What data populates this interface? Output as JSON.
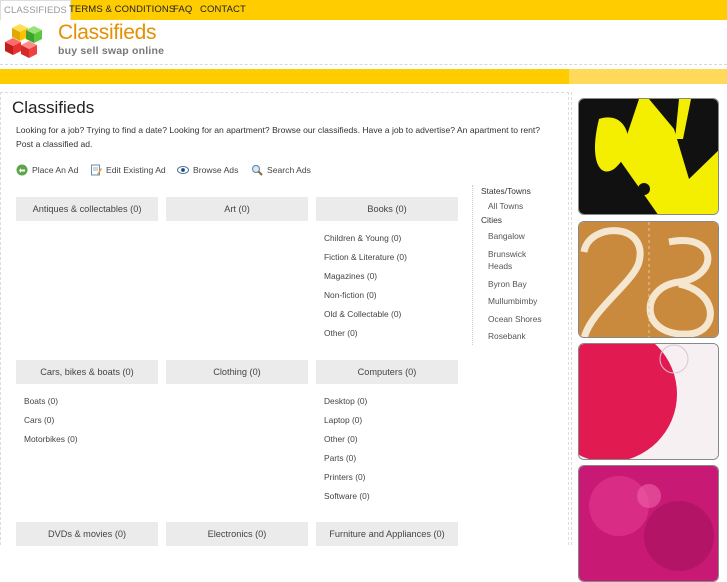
{
  "nav": [
    {
      "label": "CLASSIFIEDS"
    },
    {
      "label": "TERMS & CONDITIONS"
    },
    {
      "label": "FAQ"
    },
    {
      "label": "CONTACT"
    }
  ],
  "logo": {
    "title": "Classifieds",
    "tagline": "buy sell swap online"
  },
  "page_title": "Classifieds",
  "intro": "Looking for a job? Trying to find a date? Looking for an apartment? Browse our classifieds. Have a job to advertise? An apartment to rent? Post a classified ad.",
  "actions": [
    {
      "label": "Place An Ad",
      "icon": "place-ad-icon"
    },
    {
      "label": "Edit Existing Ad",
      "icon": "edit-ad-icon"
    },
    {
      "label": "Browse Ads",
      "icon": "eye-icon"
    },
    {
      "label": "Search Ads",
      "icon": "search-icon"
    }
  ],
  "categories": [
    {
      "label": "Antiques & collectables",
      "count": "(0)",
      "subs": []
    },
    {
      "label": "Art",
      "count": "(0)",
      "subs": []
    },
    {
      "label": "Books",
      "count": "(0)",
      "subs": [
        {
          "label": "Children & Young",
          "count": "(0)"
        },
        {
          "label": "Fiction & Literature",
          "count": "(0)"
        },
        {
          "label": "Magazines",
          "count": "(0)"
        },
        {
          "label": "Non-fiction",
          "count": "(0)"
        },
        {
          "label": "Old & Collectable",
          "count": "(0)"
        },
        {
          "label": "Other",
          "count": "(0)"
        }
      ]
    },
    {
      "label": "Cars, bikes & boats",
      "count": "(0)",
      "subs": [
        {
          "label": "Boats",
          "count": "(0)"
        },
        {
          "label": "Cars",
          "count": "(0)"
        },
        {
          "label": "Motorbikes",
          "count": "(0)"
        }
      ]
    },
    {
      "label": "Clothing",
      "count": "(0)",
      "subs": []
    },
    {
      "label": "Computers",
      "count": "(0)",
      "subs": [
        {
          "label": "Desktop",
          "count": "(0)"
        },
        {
          "label": "Laptop",
          "count": "(0)"
        },
        {
          "label": "Other",
          "count": "(0)"
        },
        {
          "label": "Parts",
          "count": "(0)"
        },
        {
          "label": "Printers",
          "count": "(0)"
        },
        {
          "label": "Software",
          "count": "(0)"
        }
      ]
    },
    {
      "label": "DVDs & movies",
      "count": "(0)",
      "subs": []
    },
    {
      "label": "Electronics",
      "count": "(0)",
      "subs": []
    },
    {
      "label": "Furniture and Appliances",
      "count": "(0)",
      "subs": []
    }
  ],
  "locations": {
    "states_heading": "States/Towns",
    "all_towns": "All Towns",
    "cities_heading": "Cities",
    "cities": [
      "Bangalow",
      "Brunswick Heads",
      "Byron Bay",
      "Mullumbimby",
      "Ocean Shores",
      "Rosebank"
    ]
  },
  "colors": {
    "accent": "#ffcc00",
    "logo_text": "#e49000",
    "category_bg": "#ebebeb"
  }
}
